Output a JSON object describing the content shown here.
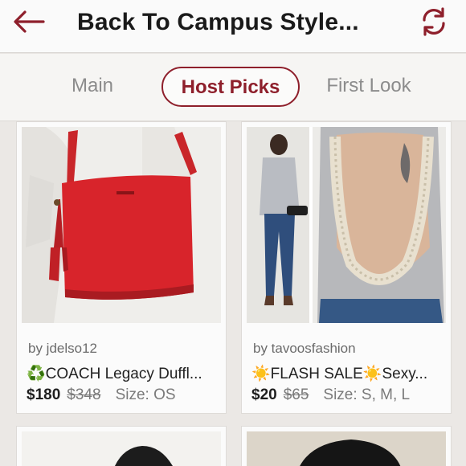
{
  "header": {
    "title": "Back To Campus Style...",
    "back_icon": "arrow-left-icon",
    "refresh_icon": "refresh-icon",
    "accent": "#8e1f2b"
  },
  "tabs": [
    {
      "label": "Main",
      "active": false
    },
    {
      "label": "Host Picks",
      "active": true
    },
    {
      "label": "First Look",
      "active": false
    }
  ],
  "listings": [
    {
      "seller": "by jdelso12",
      "title_icon": "♻️",
      "title": "COACH Legacy Duffl...",
      "price": "$180",
      "original_price": "$348",
      "size": "Size: OS"
    },
    {
      "seller": "by tavoosfashion",
      "title_icon": "☀️",
      "title": "FLASH SALE",
      "title_icon_2": "☀️",
      "title_suffix": "Sexy...",
      "price": "$20",
      "original_price": "$65",
      "size": "Size: S, M, L"
    }
  ]
}
